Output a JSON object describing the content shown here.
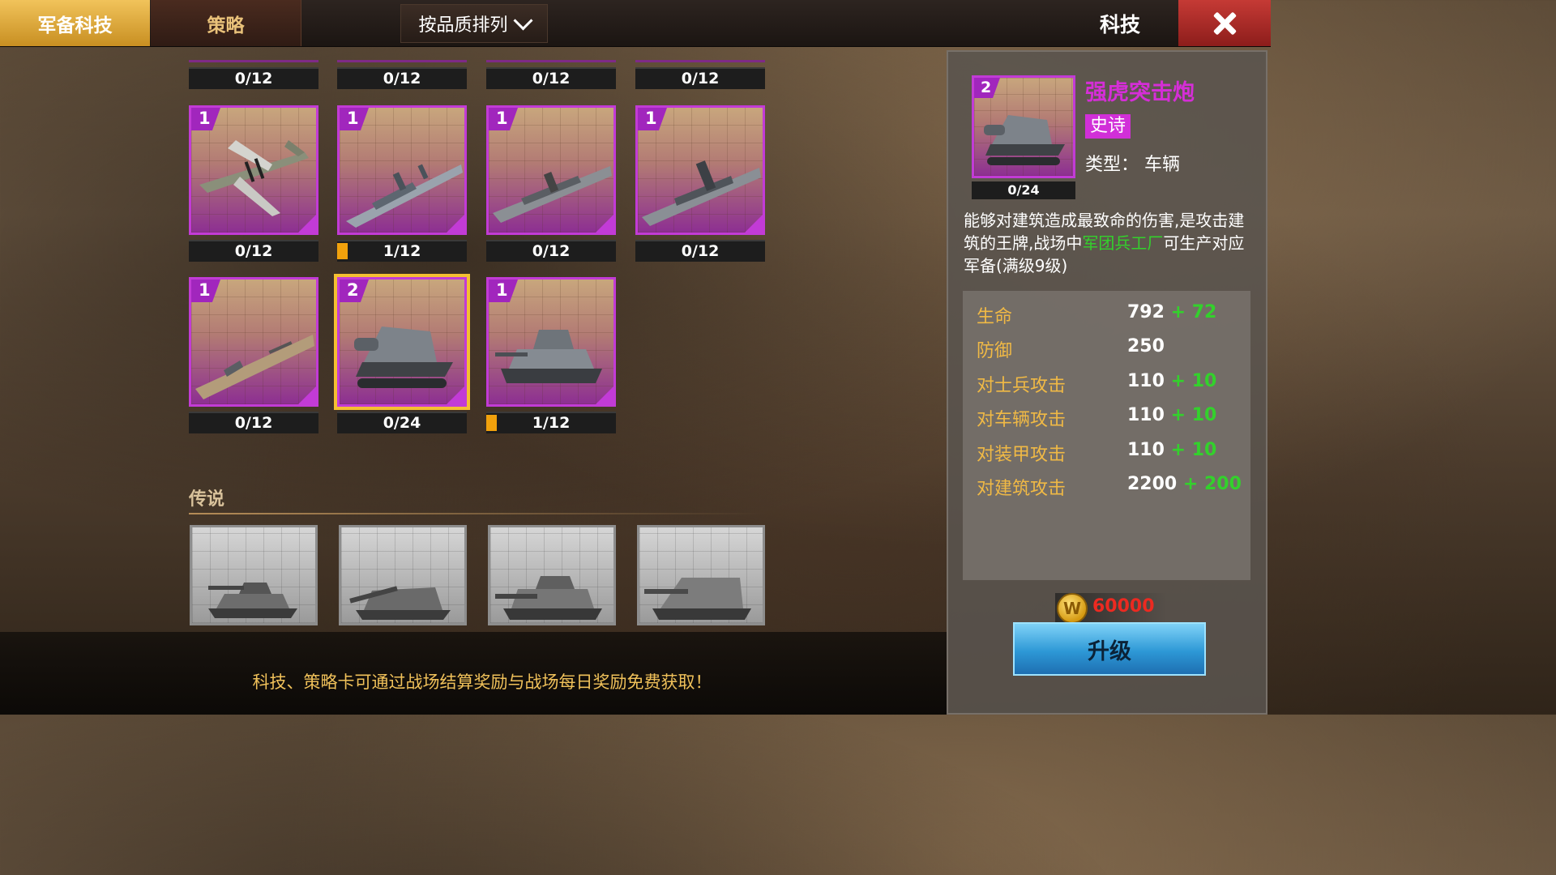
{
  "topbar": {
    "tabs": [
      {
        "label": "军备科技",
        "active": true
      },
      {
        "label": "策略",
        "active": false
      }
    ],
    "sort_label": "按品质排列",
    "title": "科技"
  },
  "grid": {
    "top_row_progress": [
      "0/12",
      "0/12",
      "0/12",
      "0/12"
    ],
    "row1": [
      {
        "level": "1",
        "progress": "0/12",
        "icon": "fighter-plane-icon"
      },
      {
        "level": "1",
        "progress": "1/12",
        "icon": "destroyer-ship-icon"
      },
      {
        "level": "1",
        "progress": "0/12",
        "icon": "cruiser-ship-icon"
      },
      {
        "level": "1",
        "progress": "0/12",
        "icon": "battleship-icon"
      }
    ],
    "row2": [
      {
        "level": "1",
        "progress": "0/12",
        "icon": "aircraft-carrier-icon"
      },
      {
        "level": "2",
        "progress": "0/24",
        "icon": "assault-gun-icon",
        "selected": true
      },
      {
        "level": "1",
        "progress": "1/12",
        "icon": "light-tank-icon"
      }
    ],
    "progress_fill_fraction": {
      "row1_1": 0.0833,
      "row2_2": 0.0833
    }
  },
  "legend_section": {
    "label": "传说",
    "cards": [
      "tank-icon",
      "artillery-icon",
      "tiger-tank-icon",
      "tank-destroyer-icon"
    ]
  },
  "footer": {
    "tip": "科技、策略卡可通过战场结算奖励与战场每日奖励免费获取！"
  },
  "detail": {
    "level": "2",
    "progress": "0/24",
    "name": "强虎突击炮",
    "rarity": "史诗",
    "type": "类型：  车辆",
    "description_pre": "能够对建筑造成最致命的伤害,是攻击建筑的王牌,战场中",
    "description_highlight": "军团兵工厂",
    "description_post": "可生产对应军备(满级9级)",
    "stats": [
      {
        "label": "生命",
        "value": "792",
        "bonus": "+ 72"
      },
      {
        "label": "防御",
        "value": "250",
        "bonus": ""
      },
      {
        "label": "对士兵攻击",
        "value": "110",
        "bonus": "+ 10"
      },
      {
        "label": "对车辆攻击",
        "value": "110",
        "bonus": "+ 10"
      },
      {
        "label": "对装甲攻击",
        "value": "110",
        "bonus": "+ 10"
      },
      {
        "label": "对建筑攻击",
        "value": "2200",
        "bonus": "+ 200"
      }
    ],
    "cost_icon": "W",
    "cost": "60000",
    "upgrade_label": "升级"
  },
  "colors": {
    "accent_gold": "#f1c35b",
    "epic_purple": "#c23bd6",
    "stat_label": "#f0b945",
    "bonus_green": "#33d12c",
    "cost_red": "#ec2a21",
    "upgrade_blue": "#2d98d6",
    "close_red": "#c53a35"
  }
}
